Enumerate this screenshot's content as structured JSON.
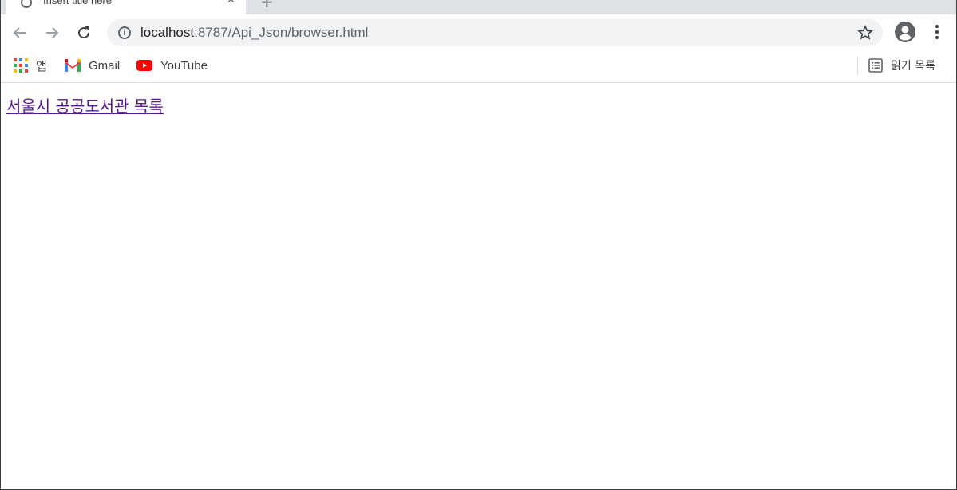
{
  "tab": {
    "title": "Insert title here",
    "close": "✕",
    "newtab": "+"
  },
  "address_bar": {
    "host": "localhost",
    "path": ":8787/Api_Json/browser.html"
  },
  "bookmarks": [
    {
      "label": "앱",
      "icon": "apps-grid-icon"
    },
    {
      "label": "Gmail",
      "icon": "gmail-icon"
    },
    {
      "label": "YouTube",
      "icon": "youtube-icon"
    }
  ],
  "reading_list": {
    "label": "읽기 목록",
    "icon": "reading-list-icon"
  },
  "page": {
    "link_text": "서울시 공공도서관 목록"
  },
  "colors": {
    "visited_link": "#551a8b",
    "tabstrip": "#dee1e6",
    "omnibox": "#f1f3f4"
  }
}
